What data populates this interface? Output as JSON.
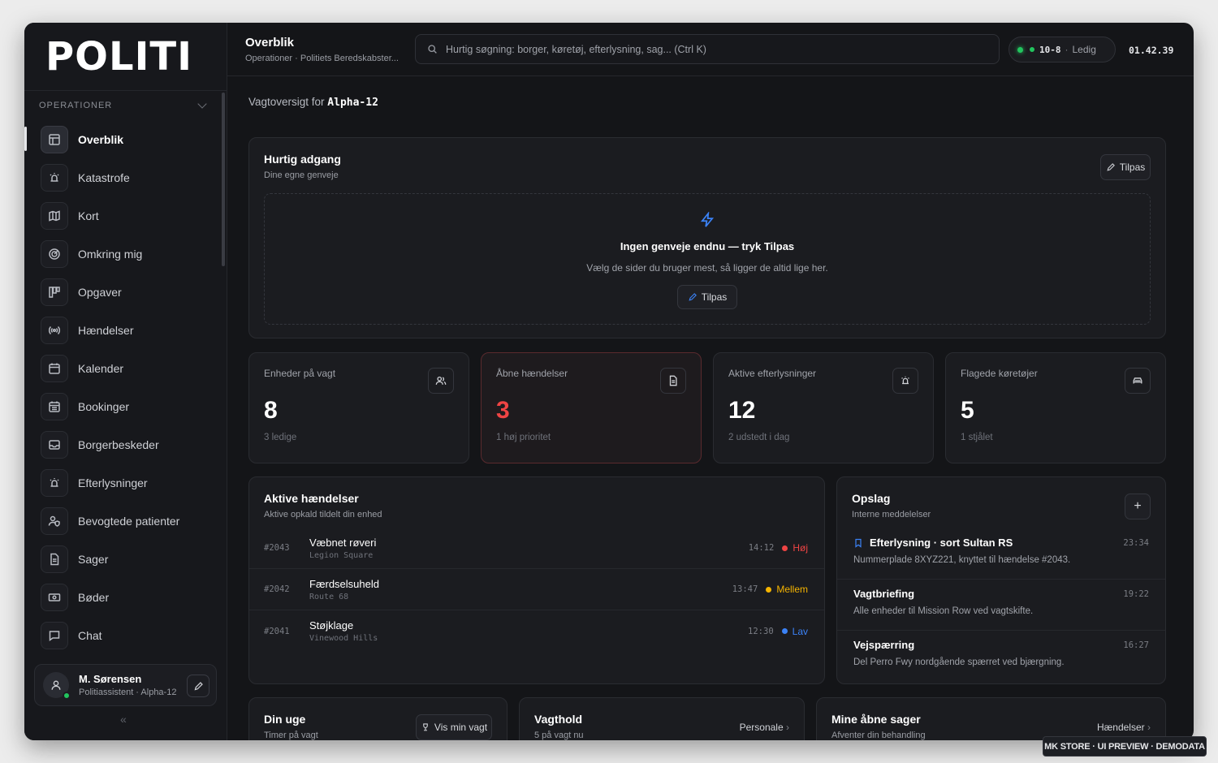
{
  "brand": {
    "logo_text": "POLITI"
  },
  "sidebar": {
    "section_label": "OPERATIONER",
    "items": [
      {
        "label": "Overblik",
        "icon": "layout-icon",
        "active": true
      },
      {
        "label": "Katastrofe",
        "icon": "siren-icon"
      },
      {
        "label": "Kort",
        "icon": "map-icon"
      },
      {
        "label": "Omkring mig",
        "icon": "radar-icon"
      },
      {
        "label": "Opgaver",
        "icon": "kanban-icon"
      },
      {
        "label": "Hændelser",
        "icon": "broadcast-icon"
      },
      {
        "label": "Kalender",
        "icon": "calendar-icon"
      },
      {
        "label": "Bookinger",
        "icon": "calendar-grid-icon"
      },
      {
        "label": "Borgerbeskeder",
        "icon": "inbox-icon"
      },
      {
        "label": "Efterlysninger",
        "icon": "siren-icon"
      },
      {
        "label": "Bevogtede patienter",
        "icon": "user-shield-icon"
      },
      {
        "label": "Sager",
        "icon": "file-icon"
      },
      {
        "label": "Bøder",
        "icon": "banknote-icon"
      },
      {
        "label": "Chat",
        "icon": "chat-icon"
      }
    ],
    "user": {
      "name": "M. Sørensen",
      "role": "Politiassistent · Alpha-12"
    },
    "collapse_glyph": "«"
  },
  "header": {
    "title": "Overblik",
    "breadcrumb": "Operationer · Politiets Beredskabster...",
    "search_placeholder": "Hurtig søgning: borger, køretøj, efterlysning, sag... (Ctrl K)",
    "status_code": "10-8",
    "status_label": "Ledig",
    "clock": "01.42.39"
  },
  "overview": {
    "prefix": "Vagtoversigt for ",
    "unit": "Alpha-12"
  },
  "quick_access": {
    "title": "Hurtig adgang",
    "subtitle": "Dine egne genveje",
    "customize_label": "Tilpas",
    "empty_title": "Ingen genveje endnu — tryk Tilpas",
    "empty_text": "Vælg de sider du bruger mest, så ligger de altid lige her.",
    "empty_button": "Tilpas"
  },
  "stats": [
    {
      "label": "Enheder på vagt",
      "value": "8",
      "sub": "3 ledige",
      "icon": "users-icon"
    },
    {
      "label": "Åbne hændelser",
      "value": "3",
      "sub": "1 høj prioritet",
      "icon": "document-icon"
    },
    {
      "label": "Aktive efterlysninger",
      "value": "12",
      "sub": "2 udstedt i dag",
      "icon": "siren-icon"
    },
    {
      "label": "Flagede køretøjer",
      "value": "5",
      "sub": "1 stjålet",
      "icon": "car-icon"
    }
  ],
  "incidents": {
    "title": "Aktive hændelser",
    "subtitle": "Aktive opkald tildelt din enhed",
    "rows": [
      {
        "id": "#2043",
        "title": "Væbnet røveri",
        "location": "Legion Square",
        "time": "14:12",
        "priority": "Høj",
        "color": "#ef4444"
      },
      {
        "id": "#2042",
        "title": "Færdselsuheld",
        "location": "Route 68",
        "time": "13:47",
        "priority": "Mellem",
        "color": "#f5b400"
      },
      {
        "id": "#2041",
        "title": "Støjklage",
        "location": "Vinewood Hills",
        "time": "12:30",
        "priority": "Lav",
        "color": "#3b82f6"
      }
    ]
  },
  "notices": {
    "title": "Opslag",
    "subtitle": "Interne meddelelser",
    "add_label": "+",
    "rows": [
      {
        "title": "Efterlysning · sort Sultan RS",
        "text": "Nummerplade 8XYZ221, knyttet til hændelse #2043.",
        "time": "23:34",
        "pinned": true
      },
      {
        "title": "Vagtbriefing",
        "text": "Alle enheder til Mission Row ved vagtskifte.",
        "time": "19:22"
      },
      {
        "title": "Vejspærring",
        "text": "Del Perro Fwy nordgående spærret ved bjærgning.",
        "time": "16:27"
      }
    ]
  },
  "bottom": {
    "week": {
      "title": "Din uge",
      "subtitle": "Timer på vagt",
      "button": "Vis min vagt"
    },
    "shift": {
      "title": "Vagthold",
      "subtitle": "5 på vagt nu",
      "link": "Personale"
    },
    "cases": {
      "title": "Mine åbne sager",
      "subtitle": "Afventer din behandling",
      "link": "Hændelser"
    }
  },
  "watermark": "MK STORE · UI PREVIEW · DEMODATA"
}
